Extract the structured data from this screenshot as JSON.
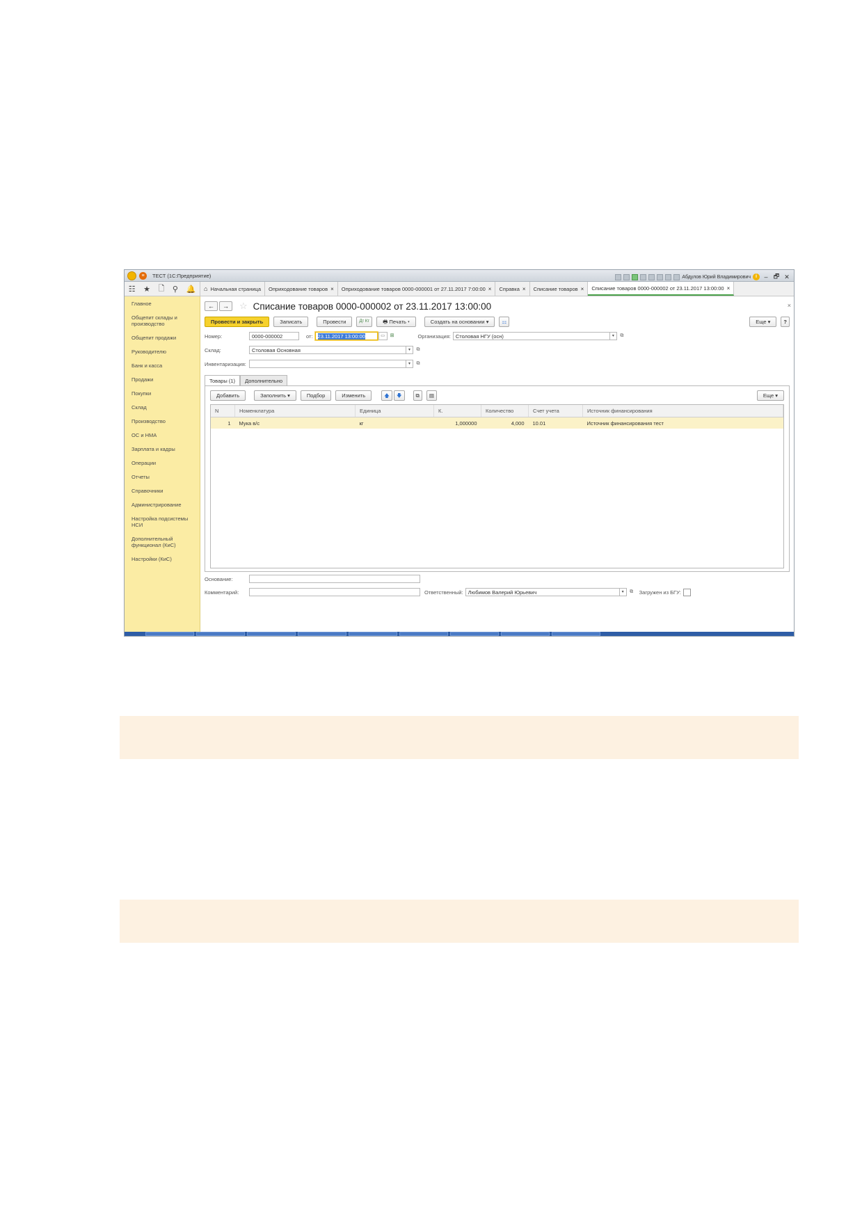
{
  "titlebar": {
    "app_title": "ТЕСТ (1С:Предприятие)",
    "user_name": "Абдулов Юрий Владимирович",
    "win_minimize": "‒",
    "win_restore": "🗗",
    "win_close": "✕",
    "info_glyph": "i"
  },
  "tools": {
    "apps": "☷",
    "favorites": "★",
    "history": "🗋",
    "search": "⚲",
    "notifications": "🔔"
  },
  "tabs": [
    {
      "label": "Начальная страница",
      "icon": "home-icon"
    },
    {
      "label": "Оприходование товаров",
      "close": "×"
    },
    {
      "label": "Оприходование товаров 0000-000001 от 27.11.2017 7:00:00",
      "close": "×"
    },
    {
      "label": "Справка",
      "close": "×"
    },
    {
      "label": "Списание товаров",
      "close": "×"
    },
    {
      "label": "Списание товаров 0000-000002 от 23.11.2017 13:00:00",
      "close": "×"
    }
  ],
  "sidebar": {
    "items": [
      "Главное",
      "Общепит склады и производство",
      "Общепит продажи",
      "Руководителю",
      "Банк и касса",
      "Продажи",
      "Покупки",
      "Склад",
      "Производство",
      "ОС и НМА",
      "Зарплата и кадры",
      "Операции",
      "Отчеты",
      "Справочники",
      "Администрирование",
      "Настройка подсистемы НСИ",
      "Дополнительный функционал (КиС)",
      "Настройки (КиС)"
    ]
  },
  "form": {
    "back": "←",
    "forward": "→",
    "star": "☆",
    "title": "Списание товаров 0000-000002 от 23.11.2017 13:00:00",
    "close": "×",
    "buttons": {
      "post_close": "Провести и закрыть",
      "save": "Записать",
      "post": "Провести",
      "dtkt": "Дт Кт",
      "print": "Печать",
      "create_based": "Создать на основании",
      "more": "Еще",
      "help": "?"
    },
    "number_label": "Номер:",
    "number_value": "0000-000002",
    "date_label": "от:",
    "date_value": "23.11.2017 13:00:00",
    "org_label": "Организация:",
    "org_value": "Столовая НГУ (осн)",
    "warehouse_label": "Склад:",
    "warehouse_value": "Столовая Основная",
    "inventory_label": "Инвентаризация:",
    "inventory_value": "",
    "ftabs": [
      "Товары (1)",
      "Дополнительно"
    ],
    "table_buttons": {
      "add": "Добавить",
      "fill": "Заполнить",
      "pick": "Подбор",
      "change": "Изменить",
      "more": "Еще"
    },
    "columns": [
      "N",
      "Номенклатура",
      "Единица",
      "К.",
      "Количество",
      "Счет учета",
      "Источник финансирования"
    ],
    "rows": [
      [
        "1",
        "Мука в/с",
        "кг",
        "1,000000",
        "4,000",
        "10.01",
        "Источник финансирования тест"
      ]
    ],
    "basis_label": "Основание:",
    "basis_value": "",
    "comment_label": "Комментарий:",
    "comment_value": "",
    "responsible_label": "Ответственный:",
    "responsible_value": "Любимов Валерий Юрьевич",
    "loaded_label": "Загружен из БГУ:",
    "loaded_checked": false
  },
  "colors": {
    "sidebar_bg": "#fbeca4",
    "primary_button": "#f6d12c",
    "selected_row": "#fbf2c8",
    "band": "#fdf1e1"
  }
}
